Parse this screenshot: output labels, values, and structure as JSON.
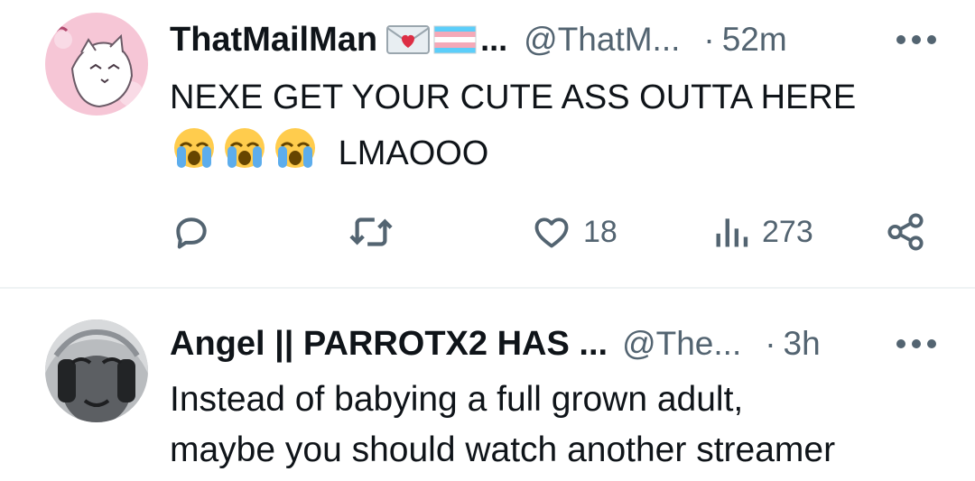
{
  "tweets": [
    {
      "name": "ThatMailMan",
      "name_truncation": "...",
      "handle": "@ThatM...",
      "separator": "·",
      "time": "52m",
      "text_line1": "NEXE GET YOUR CUTE ASS OUTTA HERE",
      "text_line2": "LMAOOO",
      "actions": {
        "likes": "18",
        "views": "273"
      }
    },
    {
      "name": "Angel || PARROTX2 HAS ...",
      "handle": "@The...",
      "separator": "·",
      "time": "3h",
      "text_line1": "Instead of babying a full grown adult,",
      "text_line2": "maybe you should watch another streamer"
    }
  ],
  "icons": [
    "love-letter-icon",
    "trans-flag-icon",
    "loudly-crying-face-icon",
    "more-icon",
    "reply-icon",
    "retweet-icon",
    "like-icon",
    "views-icon",
    "share-icon"
  ],
  "colors": {
    "text": "#0f1419",
    "secondary": "#536471",
    "divider": "#eff3f4"
  }
}
